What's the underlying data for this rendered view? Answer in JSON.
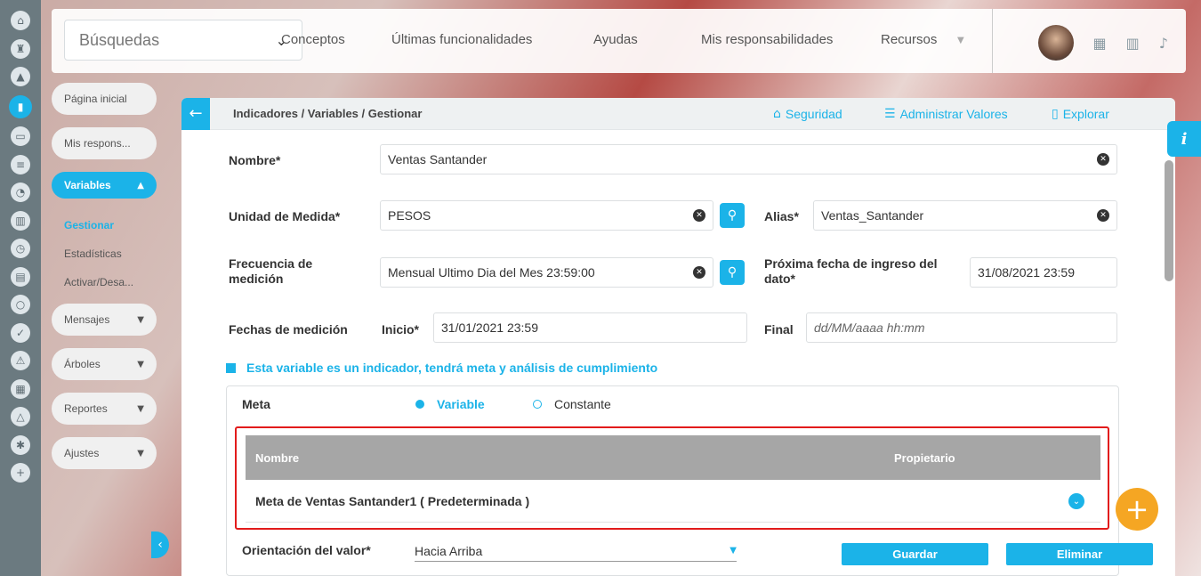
{
  "topbar": {
    "search_placeholder": "Búsquedas",
    "nav": [
      "Conceptos",
      "Últimas funcionalidades",
      "Ayudas",
      "Mis responsabilidades",
      "Recursos"
    ]
  },
  "sidebar": {
    "home_label": "Página inicial",
    "resp_label": "Mis respons...",
    "variables_label": "Variables",
    "variables_sub": [
      "Gestionar",
      "Estadísticas",
      "Activar/Desa..."
    ],
    "menu": [
      "Mensajes",
      "Árboles",
      "Reportes",
      "Ajustes"
    ]
  },
  "header": {
    "breadcrumb": "Indicadores / Variables / Gestionar",
    "seguridad": "Seguridad",
    "administrar": "Administrar Valores",
    "explorar": "Explorar"
  },
  "form": {
    "nombre_label": "Nombre*",
    "nombre_value": "Ventas Santander",
    "unidad_label": "Unidad de Medida*",
    "unidad_value": "PESOS",
    "alias_label": "Alias*",
    "alias_value": "Ventas_Santander",
    "frecuencia_label": "Frecuencia de medición",
    "frecuencia_value": "Mensual Ultimo Dia del Mes 23:59:00",
    "proxima_label": "Próxima fecha de ingreso del dato*",
    "proxima_value": "31/08/2021 23:59",
    "fechas_label": "Fechas de medición",
    "inicio_label": "Inicio*",
    "inicio_value": "31/01/2021 23:59",
    "final_label": "Final",
    "final_placeholder": "dd/MM/aaaa hh:mm",
    "indicador_text": "Esta variable es un indicador, tendrá meta y análisis de cumplimiento"
  },
  "meta": {
    "label": "Meta",
    "option_variable": "Variable",
    "option_constante": "Constante",
    "table_headers": [
      "Nombre",
      "Propietario"
    ],
    "rows": [
      "Meta de Ventas Santander1 ( Predeterminada )"
    ],
    "orientacion_label": "Orientación del valor*",
    "orientacion_value": "Hacia Arriba",
    "guardar": "Guardar",
    "eliminar": "Eliminar"
  }
}
